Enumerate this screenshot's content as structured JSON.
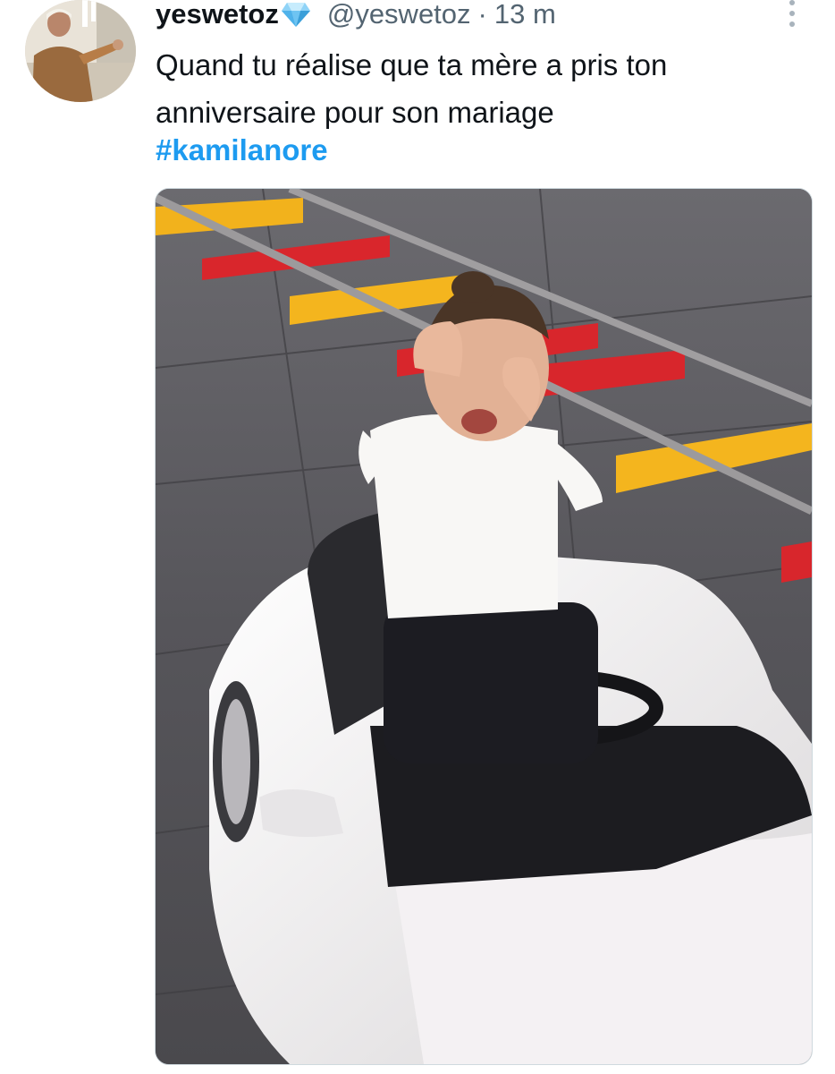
{
  "tweet": {
    "author": {
      "display_name": "yeswetoz",
      "verified_badge": "diamond-emoji",
      "handle": "@yeswetoz",
      "separator": "·",
      "timestamp": "13 m"
    },
    "text_lines": [
      "Quand tu réalise que ta mère a pris ton",
      "anniversaire pour son mariage"
    ],
    "hashtag": "#kamilanore",
    "more_icon": "vertical-dots-icon",
    "colors": {
      "hashtag": "#1d9bf0",
      "secondary_text": "#536471",
      "primary_text": "#0f1419"
    }
  }
}
